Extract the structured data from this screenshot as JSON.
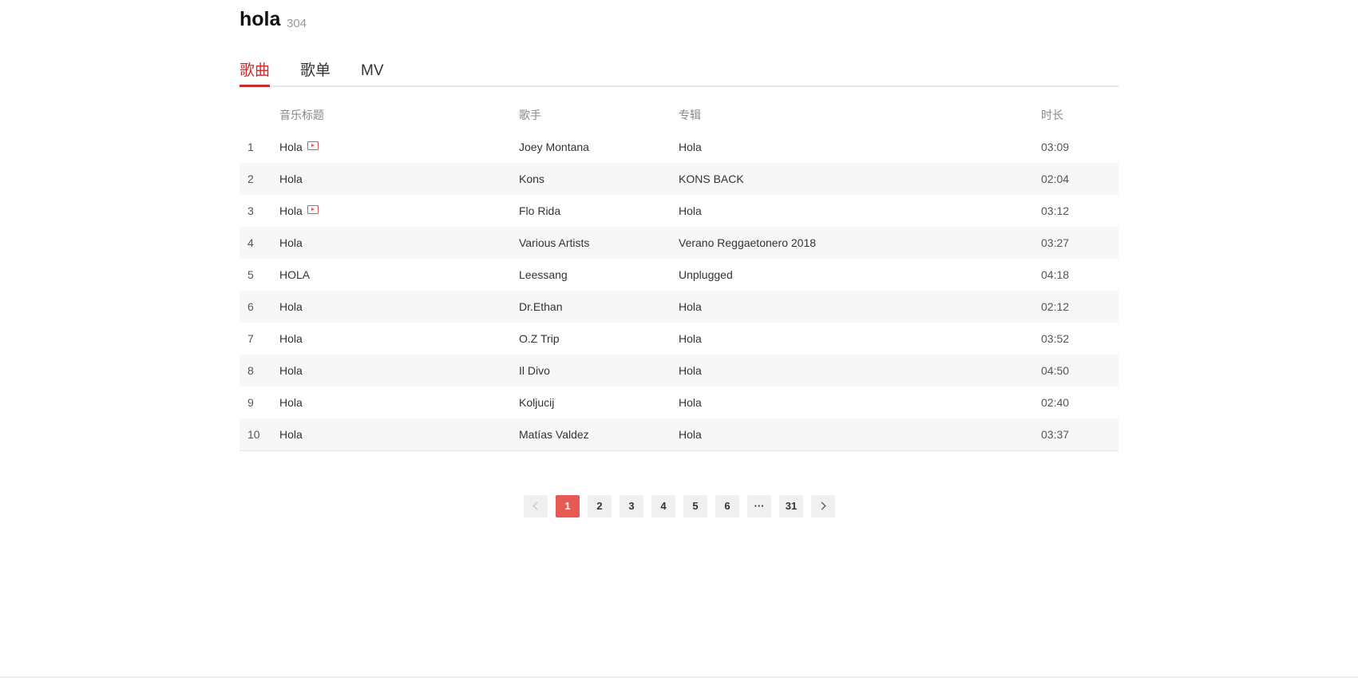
{
  "search": {
    "query": "hola",
    "result_count": "304"
  },
  "tabs": [
    {
      "label": "歌曲",
      "active": true
    },
    {
      "label": "歌单",
      "active": false
    },
    {
      "label": "MV",
      "active": false
    }
  ],
  "table": {
    "headers": {
      "title": "音乐标题",
      "artist": "歌手",
      "album": "专辑",
      "duration": "时长"
    },
    "rows": [
      {
        "index": "1",
        "title": "Hola",
        "has_mv": true,
        "artist": "Joey Montana",
        "album": "Hola",
        "duration": "03:09"
      },
      {
        "index": "2",
        "title": "Hola",
        "has_mv": false,
        "artist": "Kons",
        "album": "KONS BACK",
        "duration": "02:04"
      },
      {
        "index": "3",
        "title": "Hola",
        "has_mv": true,
        "artist": "Flo Rida",
        "album": "Hola",
        "duration": "03:12"
      },
      {
        "index": "4",
        "title": "Hola",
        "has_mv": false,
        "artist": "Various Artists",
        "album": "Verano Reggaetonero 2018",
        "duration": "03:27"
      },
      {
        "index": "5",
        "title": "HOLA",
        "has_mv": false,
        "artist": "Leessang",
        "album": "Unplugged",
        "duration": "04:18"
      },
      {
        "index": "6",
        "title": "Hola",
        "has_mv": false,
        "artist": "Dr.Ethan",
        "album": "Hola",
        "duration": "02:12"
      },
      {
        "index": "7",
        "title": "Hola",
        "has_mv": false,
        "artist": "O.Z Trip",
        "album": "Hola",
        "duration": "03:52"
      },
      {
        "index": "8",
        "title": "Hola",
        "has_mv": false,
        "artist": "Il Divo",
        "album": "Hola",
        "duration": "04:50"
      },
      {
        "index": "9",
        "title": "Hola",
        "has_mv": false,
        "artist": "Koljucij",
        "album": "Hola",
        "duration": "02:40"
      },
      {
        "index": "10",
        "title": "Hola",
        "has_mv": false,
        "artist": "Matías Valdez",
        "album": "Hola",
        "duration": "03:37"
      }
    ]
  },
  "pagination": {
    "current": "1",
    "pages": [
      "1",
      "2",
      "3",
      "4",
      "5",
      "6",
      "···",
      "31"
    ],
    "prev_icon": "chevron-left-icon",
    "next_icon": "chevron-right-icon"
  },
  "colors": {
    "accent": "#c62f2f",
    "active_page": "#e55a54",
    "mv_icon": "#e05555"
  }
}
